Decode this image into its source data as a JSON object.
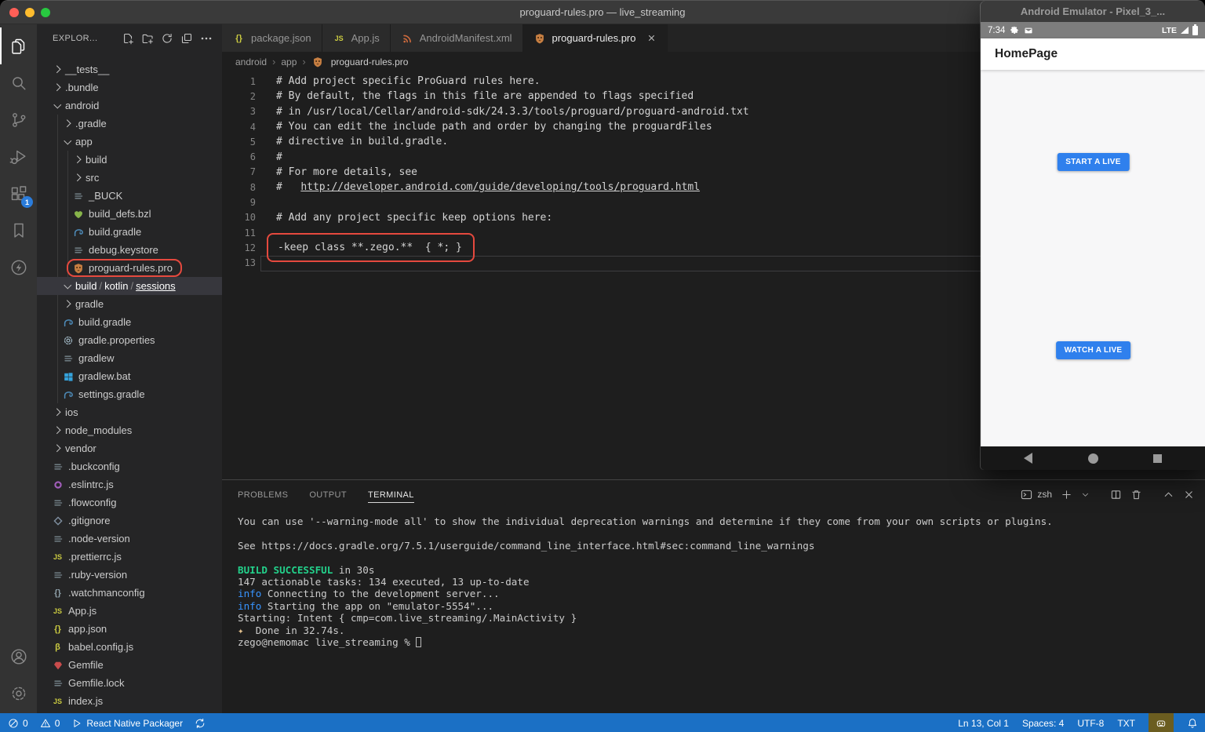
{
  "window": {
    "title": "proguard-rules.pro — live_streaming"
  },
  "colors": {
    "status_bar_blue": "#1b70c5",
    "button_blue": "#2f80ed",
    "annotation_red": "#e5493e",
    "success_green": "#23d18b",
    "info_blue": "#3794ff",
    "badge_blue": "#2a7cdb",
    "proguard_orange": "#c77f42"
  },
  "activity_bar": {
    "top": [
      {
        "name": "explorer",
        "icon": "explorer",
        "active": true
      },
      {
        "name": "search",
        "icon": "search"
      },
      {
        "name": "source-control",
        "icon": "scm"
      },
      {
        "name": "run-debug",
        "icon": "debug"
      },
      {
        "name": "extensions",
        "icon": "ext",
        "badge": "1"
      },
      {
        "name": "bookmarks",
        "icon": "bookmark"
      },
      {
        "name": "thunder",
        "icon": "zap"
      }
    ],
    "bottom": [
      {
        "name": "account",
        "icon": "account"
      },
      {
        "name": "settings",
        "icon": "gear24"
      }
    ]
  },
  "explorer": {
    "title": "EXPLOR...",
    "actions": [
      {
        "name": "new-file",
        "icon": "new-file"
      },
      {
        "name": "new-folder",
        "icon": "new-folder"
      },
      {
        "name": "refresh-explorer",
        "icon": "refresh"
      },
      {
        "name": "collapse-folders",
        "icon": "collapse"
      },
      {
        "name": "more-actions",
        "icon": "more"
      }
    ],
    "items": [
      {
        "label": "__tests__",
        "level": 0,
        "kind": "folder",
        "expanded": false
      },
      {
        "label": ".bundle",
        "level": 0,
        "kind": "folder",
        "expanded": false
      },
      {
        "label": "android",
        "level": 0,
        "kind": "folder",
        "expanded": true
      },
      {
        "label": ".gradle",
        "level": 1,
        "kind": "folder",
        "expanded": false
      },
      {
        "label": "app",
        "level": 1,
        "kind": "folder",
        "expanded": true
      },
      {
        "label": "build",
        "level": 2,
        "kind": "folder",
        "expanded": false
      },
      {
        "label": "src",
        "level": 2,
        "kind": "folder",
        "expanded": false
      },
      {
        "label": "_BUCK",
        "level": 2,
        "kind": "file",
        "icon": "list"
      },
      {
        "label": "build_defs.bzl",
        "level": 2,
        "kind": "file",
        "icon": "heart"
      },
      {
        "label": "build.gradle",
        "level": 2,
        "kind": "file",
        "icon": "gradle"
      },
      {
        "label": "debug.keystore",
        "level": 2,
        "kind": "file",
        "icon": "list"
      },
      {
        "label": "proguard-rules.pro",
        "level": 2,
        "kind": "file",
        "icon": "proguard",
        "boxed": true
      },
      {
        "parts": [
          "build",
          "kotlin",
          "sessions"
        ],
        "level": 1,
        "kind": "folder",
        "expanded": true,
        "selected": true,
        "underline_last": true
      },
      {
        "label": "gradle",
        "level": 1,
        "kind": "folder",
        "expanded": false
      },
      {
        "label": "build.gradle",
        "level": 1,
        "kind": "file",
        "icon": "gradle"
      },
      {
        "label": "gradle.properties",
        "level": 1,
        "kind": "file",
        "icon": "gearfile"
      },
      {
        "label": "gradlew",
        "level": 1,
        "kind": "file",
        "icon": "list"
      },
      {
        "label": "gradlew.bat",
        "level": 1,
        "kind": "file",
        "icon": "windows"
      },
      {
        "label": "settings.gradle",
        "level": 1,
        "kind": "file",
        "icon": "gradle"
      },
      {
        "label": "ios",
        "level": 0,
        "kind": "folder",
        "expanded": false
      },
      {
        "label": "node_modules",
        "level": 0,
        "kind": "folder",
        "expanded": false
      },
      {
        "label": "vendor",
        "level": 0,
        "kind": "folder",
        "expanded": false
      },
      {
        "label": ".buckconfig",
        "level": 0,
        "kind": "file",
        "icon": "list"
      },
      {
        "label": ".eslintrc.js",
        "level": 0,
        "kind": "file",
        "icon": "eslint"
      },
      {
        "label": ".flowconfig",
        "level": 0,
        "kind": "file",
        "icon": "list"
      },
      {
        "label": ".gitignore",
        "level": 0,
        "kind": "file",
        "icon": "git"
      },
      {
        "label": ".node-version",
        "level": 0,
        "kind": "file",
        "icon": "list"
      },
      {
        "label": ".prettierrc.js",
        "level": 0,
        "kind": "file",
        "icon": "js"
      },
      {
        "label": ".ruby-version",
        "level": 0,
        "kind": "file",
        "icon": "list"
      },
      {
        "label": ".watchmanconfig",
        "level": 0,
        "kind": "file",
        "icon": "braces-gray"
      },
      {
        "label": "App.js",
        "level": 0,
        "kind": "file",
        "icon": "js"
      },
      {
        "label": "app.json",
        "level": 0,
        "kind": "file",
        "icon": "braces"
      },
      {
        "label": "babel.config.js",
        "level": 0,
        "kind": "file",
        "icon": "babel"
      },
      {
        "label": "Gemfile",
        "level": 0,
        "kind": "file",
        "icon": "gem"
      },
      {
        "label": "Gemfile.lock",
        "level": 0,
        "kind": "file",
        "icon": "list"
      },
      {
        "label": "index.js",
        "level": 0,
        "kind": "file",
        "icon": "js"
      }
    ]
  },
  "tabs": [
    {
      "label": "package.json",
      "icon": "braces",
      "active": false
    },
    {
      "label": "App.js",
      "icon": "js",
      "active": false
    },
    {
      "label": "AndroidManifest.xml",
      "icon": "rss",
      "active": false
    },
    {
      "label": "proguard-rules.pro",
      "icon": "proguard",
      "active": true,
      "closable": true
    }
  ],
  "breadcrumb": {
    "folders": [
      "android",
      "app"
    ],
    "file": "proguard-rules.pro",
    "file_icon": "proguard"
  },
  "editor": {
    "lines": [
      {
        "n": 1,
        "text": "# Add project specific ProGuard rules here."
      },
      {
        "n": 2,
        "text": "# By default, the flags in this file are appended to flags specified"
      },
      {
        "n": 3,
        "text": "# in /usr/local/Cellar/android-sdk/24.3.3/tools/proguard/proguard-android.txt"
      },
      {
        "n": 4,
        "text": "# You can edit the include path and order by changing the proguardFiles"
      },
      {
        "n": 5,
        "text": "# directive in build.gradle."
      },
      {
        "n": 6,
        "text": "#"
      },
      {
        "n": 7,
        "text": "# For more details, see"
      },
      {
        "n": 8,
        "prefix": "#   ",
        "link": "http://developer.android.com/guide/developing/tools/proguard.html"
      },
      {
        "n": 9,
        "text": ""
      },
      {
        "n": 10,
        "text": "# Add any project specific keep options here:"
      },
      {
        "n": 11,
        "text": ""
      },
      {
        "n": 12,
        "text": "-keep class **.zego.**  { *; }",
        "boxed": true
      },
      {
        "n": 13,
        "text": "",
        "cursor": true
      }
    ]
  },
  "panel": {
    "tabs": [
      {
        "label": "PROBLEMS",
        "active": false
      },
      {
        "label": "OUTPUT",
        "active": false
      },
      {
        "label": "TERMINAL",
        "active": true
      }
    ],
    "shell": "zsh",
    "lines": [
      [
        {
          "t": "You can use '--warning-mode all' to show the individual deprecation warnings and determine if they come from your own scripts or plugins."
        }
      ],
      [],
      [
        {
          "t": "See https://docs.gradle.org/7.5.1/userguide/command_line_interface.html#sec:command_line_warnings"
        }
      ],
      [],
      [
        {
          "t": "BUILD SUCCESSFUL",
          "c": "tg"
        },
        {
          "t": " in 30s"
        }
      ],
      [
        {
          "t": "147 actionable tasks: 134 executed, 13 up-to-date"
        }
      ],
      [
        {
          "t": "info",
          "c": "tb"
        },
        {
          "t": " Connecting to the development server..."
        }
      ],
      [
        {
          "t": "info",
          "c": "tb"
        },
        {
          "t": " Starting the app on \"emulator-5554\"..."
        }
      ],
      [
        {
          "t": "Starting: Intent { cmp=com.live_streaming/.MainActivity }"
        }
      ],
      [
        {
          "t": "✦",
          "c": "ty"
        },
        {
          "t": "  Done in 32.74s."
        }
      ],
      [
        {
          "t": "zego@nemomac live_streaming % "
        },
        {
          "t": "",
          "c": "cursor"
        }
      ]
    ]
  },
  "status_bar": {
    "left": [
      {
        "name": "errors",
        "icon": "error",
        "text": "0"
      },
      {
        "name": "warnings",
        "icon": "warning",
        "text": "0"
      },
      {
        "name": "react-native-packager",
        "icon": "play",
        "text": "React Native Packager"
      },
      {
        "name": "sync",
        "icon": "sync",
        "text": ""
      }
    ],
    "right": [
      {
        "name": "cursor-position",
        "text": "Ln 13, Col 1"
      },
      {
        "name": "indentation",
        "text": "Spaces: 4"
      },
      {
        "name": "encoding",
        "text": "UTF-8"
      },
      {
        "name": "language-mode",
        "text": "TXT"
      },
      {
        "name": "ai-assistant",
        "icon": "robot",
        "highlight": true
      },
      {
        "name": "notifications",
        "icon": "bell"
      }
    ]
  },
  "emulator": {
    "title": "Android Emulator - Pixel_3_...",
    "status_time": "7:34",
    "network": "LTE",
    "app_title": "HomePage",
    "buttons": [
      "START A LIVE",
      "WATCH A LIVE"
    ],
    "nav": [
      {
        "name": "back"
      },
      {
        "name": "home"
      },
      {
        "name": "overview"
      }
    ]
  }
}
